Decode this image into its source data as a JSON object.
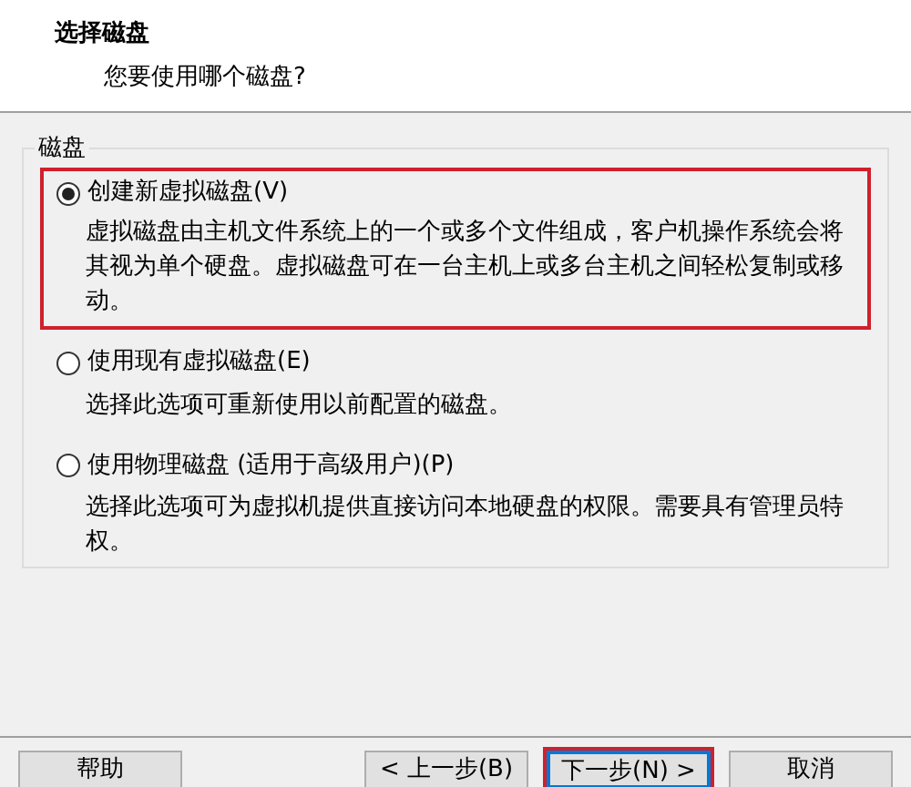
{
  "header": {
    "title": "选择磁盘",
    "subtitle": "您要使用哪个磁盘?"
  },
  "group": {
    "label": "磁盘",
    "options": [
      {
        "label": "创建新虚拟磁盘(V)",
        "selected": true,
        "highlighted": true,
        "description": "虚拟磁盘由主机文件系统上的一个或多个文件组成，客户机操作系统会将其视为单个硬盘。虚拟磁盘可在一台主机上或多台主机之间轻松复制或移动。"
      },
      {
        "label": "使用现有虚拟磁盘(E)",
        "selected": false,
        "highlighted": false,
        "description": "选择此选项可重新使用以前配置的磁盘。"
      },
      {
        "label": "使用物理磁盘 (适用于高级用户)(P)",
        "selected": false,
        "highlighted": false,
        "description": "选择此选项可为虚拟机提供直接访问本地硬盘的权限。需要具有管理员特权。"
      }
    ]
  },
  "buttons": [
    {
      "label": "帮助",
      "default": false,
      "highlighted": false
    },
    {
      "label": "< 上一步(B)",
      "default": false,
      "highlighted": false
    },
    {
      "label": "下一步(N) >",
      "default": true,
      "highlighted": true
    },
    {
      "label": "取消",
      "default": false,
      "highlighted": false
    }
  ]
}
